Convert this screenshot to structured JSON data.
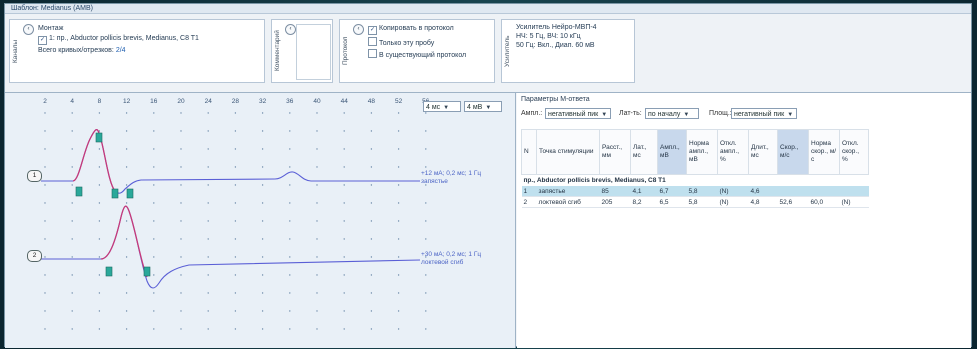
{
  "window": {
    "title": "Шаблон: Medianus (AMB)"
  },
  "montage": {
    "side_label": "Каналы",
    "title": "Монтаж",
    "channel": "1: пр., Abductor pollicis brevis, Medianus, C8 T1",
    "total_label": "Всего кривых/отрезков:",
    "total_value": "2/4"
  },
  "comments": {
    "side_label": "Комментарий"
  },
  "protocol": {
    "side_label": "Протокол",
    "copy_label": "Копировать в протокол",
    "copy_checked": true,
    "only_sample_label": "Только эту пробу",
    "existing_label": "В существующий протокол"
  },
  "amplifier": {
    "side_label": "Усилитель",
    "line1": "Усилитель Нейро-МВП-4",
    "line2": "НЧ: 5 Гц, ВЧ: 10 кГц",
    "line3": "50 Гц: Вкл., Диап. 60 мВ"
  },
  "graph": {
    "ticks": [
      "2",
      "4",
      "8",
      "12",
      "16",
      "20",
      "24",
      "28",
      "32",
      "36",
      "40",
      "44",
      "48",
      "52",
      "56"
    ],
    "sweep": "4 мс",
    "sens": "4 мВ",
    "trace1": {
      "channel": "1",
      "info_line1": "+12 мА; 0,2 мс; 1 Гц",
      "info_line2": "запястье"
    },
    "trace2": {
      "channel": "2",
      "info_line1": "+30 мА; 0,2 мс; 1 Гц",
      "info_line2": "локтевой сгиб"
    }
  },
  "mresponse": {
    "title": "Параметры М-ответа",
    "amp_label": "Ампл.:",
    "amp_value": "негативный пик",
    "lat_label": "Лат-ть:",
    "lat_value": "по началу",
    "area_label": "Площ.:",
    "area_value": "негативный пик",
    "columns": [
      "N",
      "Точка стимуляции",
      "Расст., мм",
      "Лат., мс",
      "Ампл., мВ",
      "Норма ампл., мВ",
      "Откл. ампл., %",
      "Длит., мс",
      "Скор., м/с",
      "Норма скор., м/с",
      "Откл. скор., %"
    ],
    "group_title": "пр., Abductor pollicis brevis, Medianus, C8 T1",
    "rows": [
      [
        "1",
        "запястье",
        "85",
        "4,1",
        "6,7",
        "5,8",
        "(N)",
        "4,6",
        "",
        "",
        ""
      ],
      [
        "2",
        "локтевой сгиб",
        "205",
        "8,2",
        "6,5",
        "5,8",
        "(N)",
        "4,8",
        "52,6",
        "60,0",
        "(N)"
      ]
    ]
  },
  "colors": {
    "trace": "#5a5fd6",
    "selected_segment": "#c63a7a",
    "marker": "#2aa89a",
    "grid_bg": "#e9f0f7"
  }
}
